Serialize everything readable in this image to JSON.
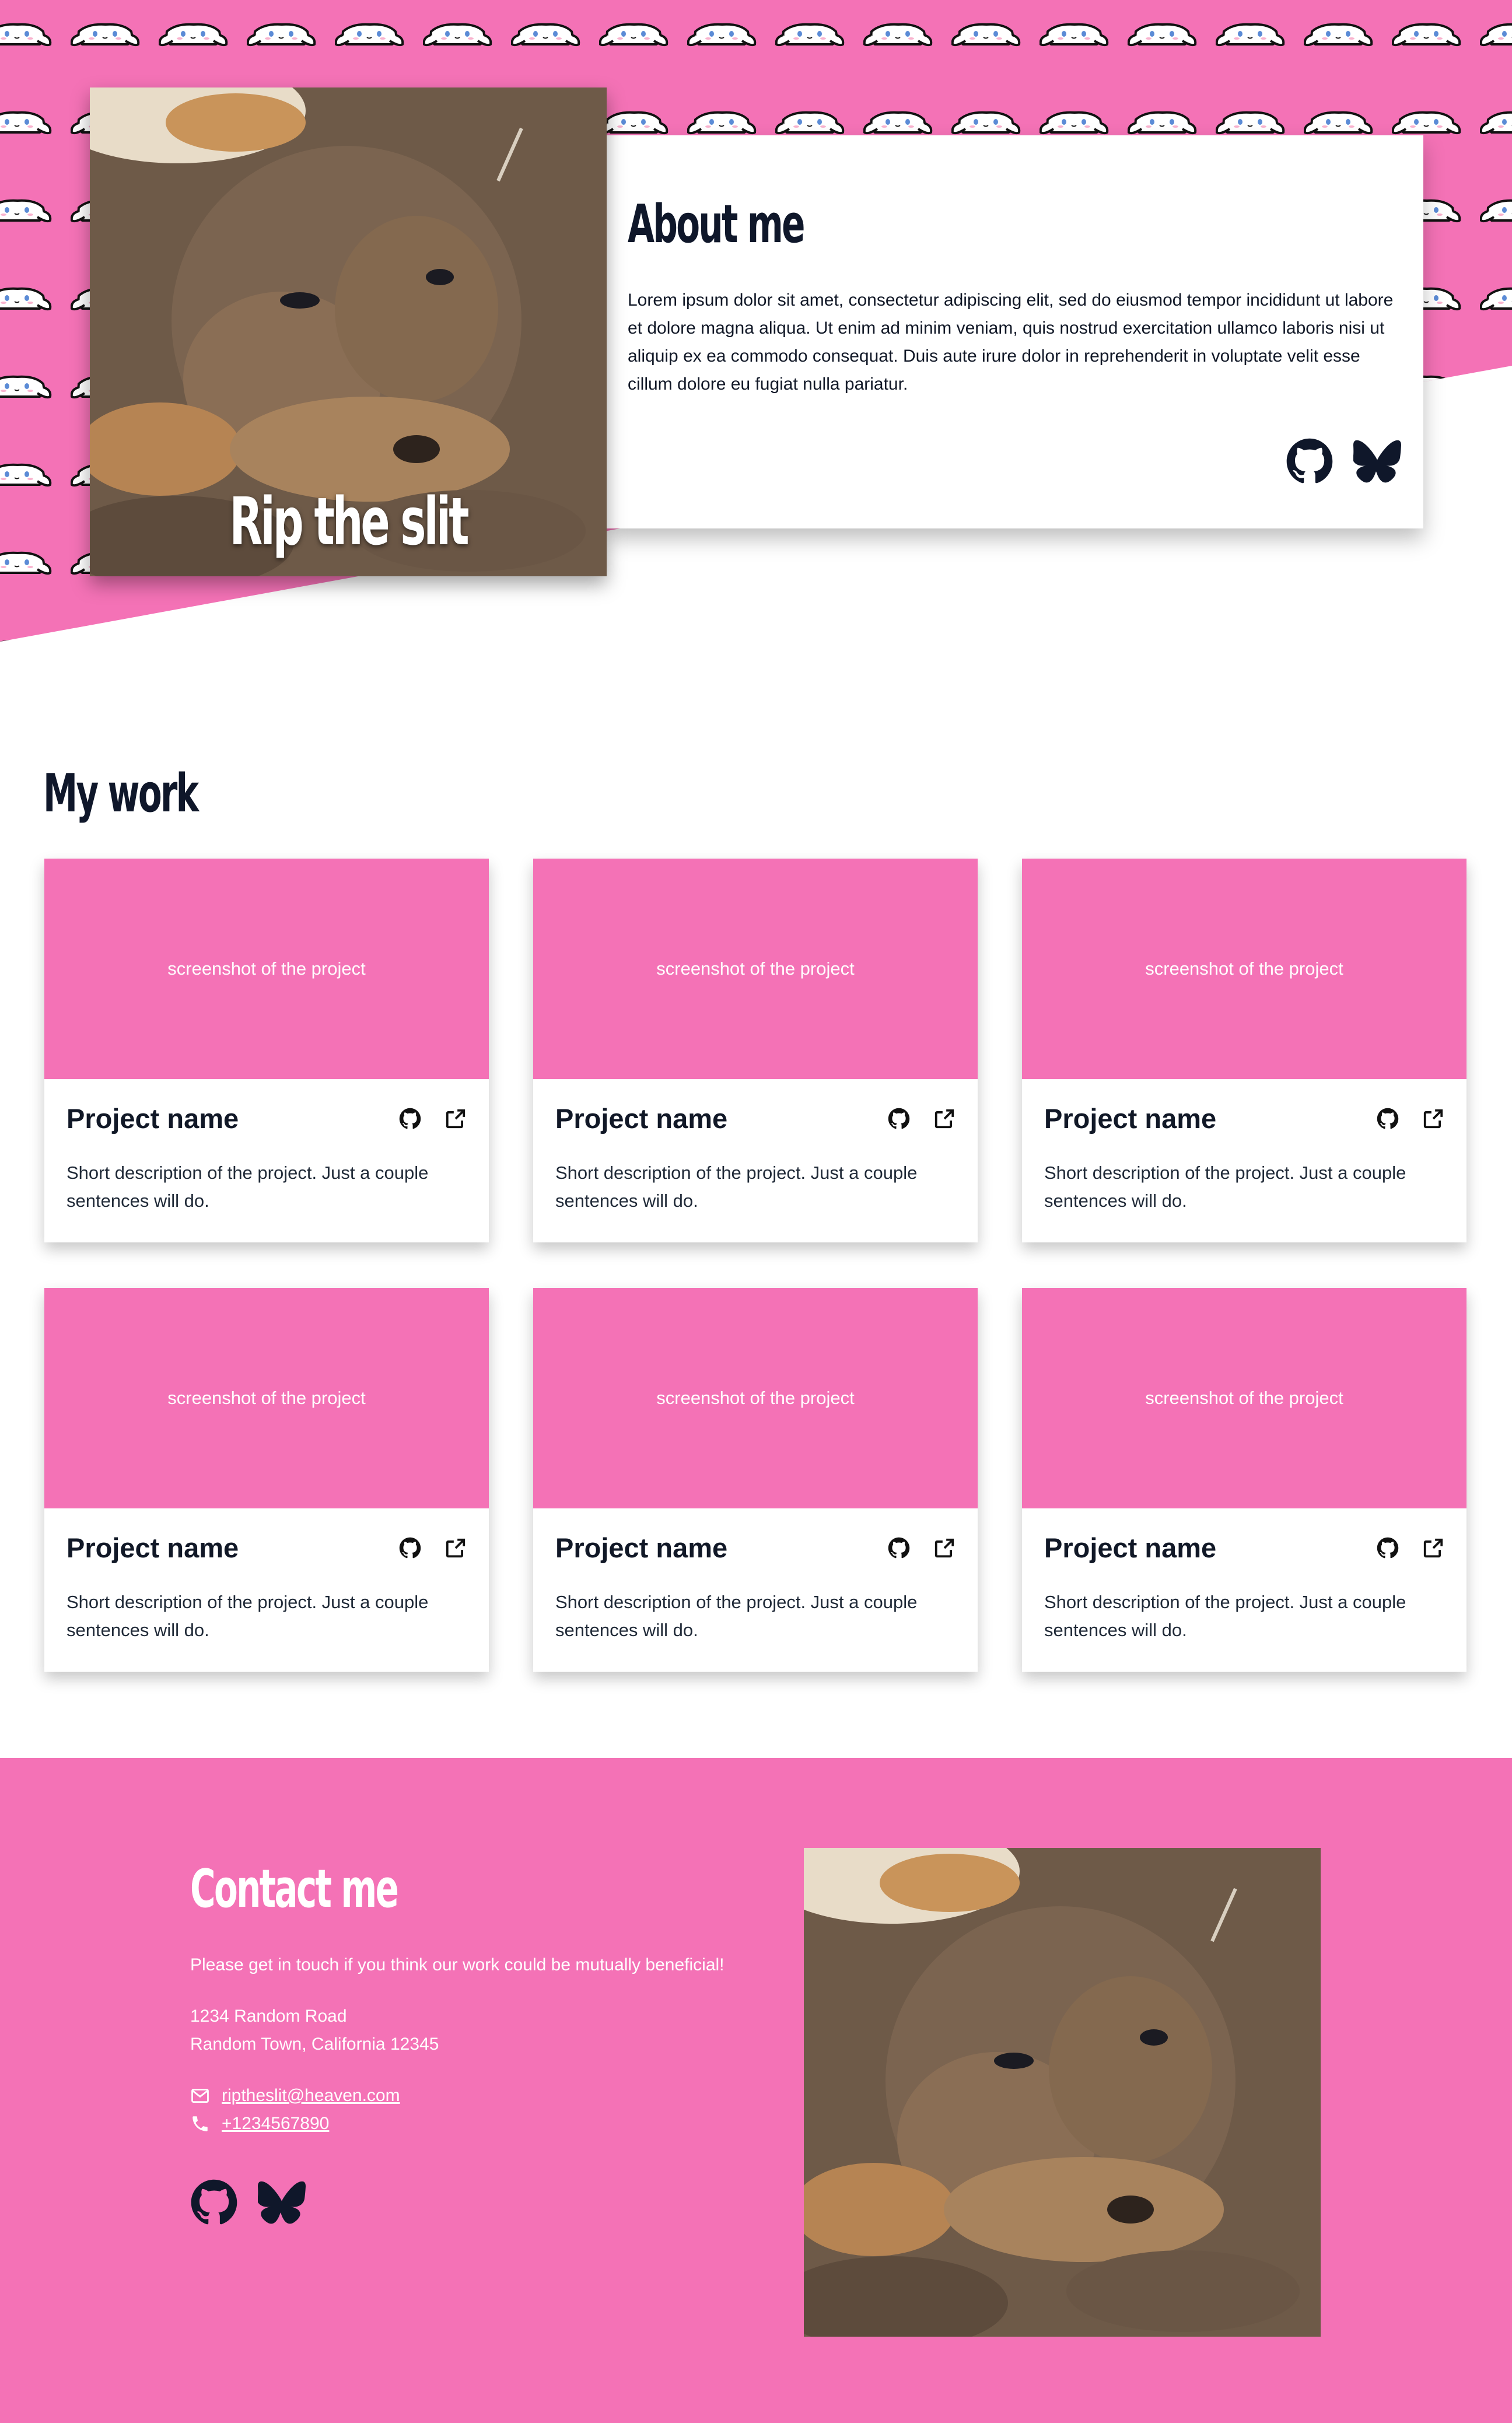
{
  "hero": {
    "name": "Rip the slit",
    "photo_icon": "puppy-photo",
    "pattern_icon": "cinnamoroll-pattern"
  },
  "about": {
    "title": "About me",
    "text": "Lorem ipsum dolor sit amet, consectetur adipiscing elit, sed do eiusmod tempor incididunt ut labore et dolore magna aliqua. Ut enim ad minim veniam, quis nostrud exercitation ullamco laboris nisi ut aliquip ex ea commodo consequat. Duis aute irure dolor in reprehenderit in voluptate velit esse cillum dolore eu fugiat nulla pariatur.",
    "icons": [
      "github-icon",
      "bluesky-icon"
    ]
  },
  "work": {
    "title": "My work",
    "projects": [
      {
        "screenshot": "screenshot of the project",
        "name": "Project name",
        "description": "Short description of the project. Just a couple sentences will do."
      },
      {
        "screenshot": "screenshot of the project",
        "name": "Project name",
        "description": "Short description of the project. Just a couple sentences will do."
      },
      {
        "screenshot": "screenshot of the project",
        "name": "Project name",
        "description": "Short description of the project. Just a couple sentences will do."
      },
      {
        "screenshot": "screenshot of the project",
        "name": "Project name",
        "description": "Short description of the project. Just a couple sentences will do."
      },
      {
        "screenshot": "screenshot of the project",
        "name": "Project name",
        "description": "Short description of the project. Just a couple sentences will do."
      },
      {
        "screenshot": "screenshot of the project",
        "name": "Project name",
        "description": "Short description of the project. Just a couple sentences will do."
      }
    ],
    "card_icons": [
      "github-icon",
      "external-link-icon"
    ]
  },
  "contact": {
    "title": "Contact me",
    "text": "Please get in touch if you think our work could be mutually beneficial!",
    "address_line1": "1234 Random Road",
    "address_line2": "Random Town, California 12345",
    "email": "riptheslit@heaven.com",
    "phone": "+1234567890",
    "icons": [
      "mail-icon",
      "phone-icon",
      "github-icon",
      "bluesky-icon"
    ]
  },
  "colors": {
    "accent": "#f472b6",
    "heading": "#0f172a",
    "text": "#111827",
    "white": "#ffffff"
  }
}
